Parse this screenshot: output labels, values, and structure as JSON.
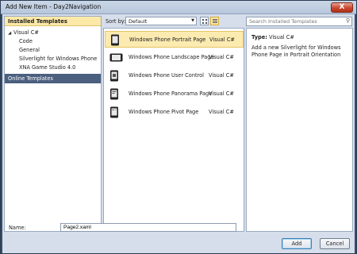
{
  "window": {
    "title": "Add New Item - Day2Navigation",
    "close_glyph": "X"
  },
  "left": {
    "installed_header": "Installed Templates",
    "tree": [
      {
        "label": "Visual C#",
        "expanded": true
      },
      {
        "label": "Code"
      },
      {
        "label": "General"
      },
      {
        "label": "Silverlight for Windows Phone"
      },
      {
        "label": "XNA Game Studio 4.0"
      }
    ],
    "online": "Online Templates"
  },
  "toolbar": {
    "sort_label": "Sort by:",
    "sort_value": "Default",
    "search_placeholder": "Search Installed Templates",
    "active_view": "list"
  },
  "templates": [
    {
      "name": "Windows Phone Portrait Page",
      "lang": "Visual C#",
      "icon": "portrait-page-icon",
      "selected": true
    },
    {
      "name": "Windows Phone Landscape Page",
      "lang": "Visual C#",
      "icon": "landscape-page-icon"
    },
    {
      "name": "Windows Phone User Control",
      "lang": "Visual C#",
      "icon": "user-control-icon"
    },
    {
      "name": "Windows Phone Panorama Page",
      "lang": "Visual C#",
      "icon": "panorama-page-icon"
    },
    {
      "name": "Windows Phone Pivot Page",
      "lang": "Visual C#",
      "icon": "pivot-page-icon"
    }
  ],
  "detail": {
    "type_label": "Type:",
    "type_value": "Visual C#",
    "description": "Add a new Silverlight for Windows Phone Page in Portrait Orientation"
  },
  "bottom": {
    "name_label": "Name:",
    "name_value": "Page2.xaml",
    "add_label": "Add",
    "cancel_label": "Cancel"
  },
  "colors": {
    "selection": "#fcebb0",
    "frame": "#3a4e69",
    "online_row": "#4b5f7e"
  }
}
